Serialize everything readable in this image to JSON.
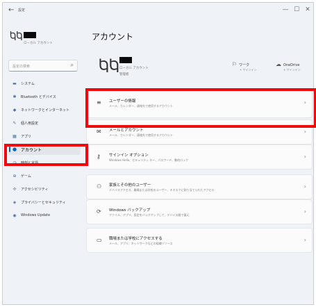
{
  "window": {
    "title": "設定",
    "back_glyph": "←",
    "controls": {
      "minimize": "—",
      "maximize": "☐",
      "close": "✕"
    }
  },
  "sidebar": {
    "profile": {
      "sub": "ローカル アカウント"
    },
    "search": {
      "placeholder": "設定の検索"
    },
    "items": [
      {
        "label": "システム",
        "icon": "monitor-icon",
        "glyph": "▬"
      },
      {
        "label": "Bluetooth とデバイス",
        "icon": "bluetooth-icon",
        "glyph": "✱"
      },
      {
        "label": "ネットワークとインターネット",
        "icon": "network-icon",
        "glyph": "◆"
      },
      {
        "label": "個人用設定",
        "icon": "pen-icon",
        "glyph": "✎"
      },
      {
        "label": "アプリ",
        "icon": "apps-icon",
        "glyph": "▦"
      },
      {
        "label": "アカウント",
        "icon": "person-icon",
        "glyph": "●"
      },
      {
        "label": "時刻と言語",
        "icon": "clock-icon",
        "glyph": "◷"
      },
      {
        "label": "ゲーム",
        "icon": "game-icon",
        "glyph": "⊕"
      },
      {
        "label": "アクセシビリティ",
        "icon": "accessibility-icon",
        "glyph": "✢"
      },
      {
        "label": "プライバシーとセキュリティ",
        "icon": "shield-icon",
        "glyph": "◈"
      },
      {
        "label": "Windows Update",
        "icon": "update-icon",
        "glyph": "◉"
      }
    ],
    "active_index": 5
  },
  "main": {
    "title": "アカウント",
    "account": {
      "type": "ローカル アカウント",
      "role": "管理者"
    },
    "services": [
      {
        "name": "ワーク",
        "sub": "+ サインイン",
        "icon": "rewards-icon",
        "glyph": "⚐"
      },
      {
        "name": "OneDrive",
        "sub": "+ サインイン",
        "icon": "cloud-icon",
        "glyph": "☁"
      }
    ],
    "cards": [
      {
        "title": "ユーザーの情報",
        "desc": "メール、カレンダー、連絡先で使用するアカウント",
        "icon": "user-info-icon",
        "glyph": "≡"
      },
      {
        "title": "メールとアカウント",
        "desc": "メール、カレンダー、連絡先で使用するアカウント",
        "icon": "mail-icon",
        "glyph": "✉"
      },
      {
        "title": "サインイン オプション",
        "desc": "Windows Hello、セキュリティ キー、パスワード、動的ロック",
        "icon": "key-icon",
        "glyph": "⚷"
      },
      {
        "title": "家族とその他のユーザー",
        "desc": "デバイスアクセス、職場または学校のユーザー、キオスクに割り当てられたアクセス",
        "icon": "family-icon",
        "glyph": "⚇"
      },
      {
        "title": "Windows バックアップ",
        "desc": "ファイル、アプリ、設定をバックアップして、デバイス間で復元",
        "icon": "backup-icon",
        "glyph": "⟳"
      },
      {
        "title": "職場または学校にアクセスする",
        "desc": "メール、アプリ、ネットワークなどの組織リソース",
        "icon": "briefcase-icon",
        "glyph": "▭"
      }
    ],
    "chevron": "›"
  },
  "highlights": {
    "color": "#ee0a0a",
    "targets": [
      "card-user-info",
      "sidebar-item-account"
    ]
  }
}
